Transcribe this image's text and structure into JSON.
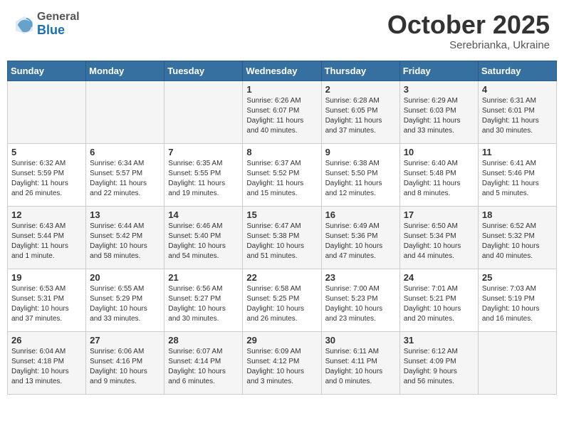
{
  "header": {
    "logo_general": "General",
    "logo_blue": "Blue",
    "month": "October 2025",
    "location": "Serebrianka, Ukraine"
  },
  "weekdays": [
    "Sunday",
    "Monday",
    "Tuesday",
    "Wednesday",
    "Thursday",
    "Friday",
    "Saturday"
  ],
  "weeks": [
    [
      {
        "day": "",
        "content": ""
      },
      {
        "day": "",
        "content": ""
      },
      {
        "day": "",
        "content": ""
      },
      {
        "day": "1",
        "content": "Sunrise: 6:26 AM\nSunset: 6:07 PM\nDaylight: 11 hours\nand 40 minutes."
      },
      {
        "day": "2",
        "content": "Sunrise: 6:28 AM\nSunset: 6:05 PM\nDaylight: 11 hours\nand 37 minutes."
      },
      {
        "day": "3",
        "content": "Sunrise: 6:29 AM\nSunset: 6:03 PM\nDaylight: 11 hours\nand 33 minutes."
      },
      {
        "day": "4",
        "content": "Sunrise: 6:31 AM\nSunset: 6:01 PM\nDaylight: 11 hours\nand 30 minutes."
      }
    ],
    [
      {
        "day": "5",
        "content": "Sunrise: 6:32 AM\nSunset: 5:59 PM\nDaylight: 11 hours\nand 26 minutes."
      },
      {
        "day": "6",
        "content": "Sunrise: 6:34 AM\nSunset: 5:57 PM\nDaylight: 11 hours\nand 22 minutes."
      },
      {
        "day": "7",
        "content": "Sunrise: 6:35 AM\nSunset: 5:55 PM\nDaylight: 11 hours\nand 19 minutes."
      },
      {
        "day": "8",
        "content": "Sunrise: 6:37 AM\nSunset: 5:52 PM\nDaylight: 11 hours\nand 15 minutes."
      },
      {
        "day": "9",
        "content": "Sunrise: 6:38 AM\nSunset: 5:50 PM\nDaylight: 11 hours\nand 12 minutes."
      },
      {
        "day": "10",
        "content": "Sunrise: 6:40 AM\nSunset: 5:48 PM\nDaylight: 11 hours\nand 8 minutes."
      },
      {
        "day": "11",
        "content": "Sunrise: 6:41 AM\nSunset: 5:46 PM\nDaylight: 11 hours\nand 5 minutes."
      }
    ],
    [
      {
        "day": "12",
        "content": "Sunrise: 6:43 AM\nSunset: 5:44 PM\nDaylight: 11 hours\nand 1 minute."
      },
      {
        "day": "13",
        "content": "Sunrise: 6:44 AM\nSunset: 5:42 PM\nDaylight: 10 hours\nand 58 minutes."
      },
      {
        "day": "14",
        "content": "Sunrise: 6:46 AM\nSunset: 5:40 PM\nDaylight: 10 hours\nand 54 minutes."
      },
      {
        "day": "15",
        "content": "Sunrise: 6:47 AM\nSunset: 5:38 PM\nDaylight: 10 hours\nand 51 minutes."
      },
      {
        "day": "16",
        "content": "Sunrise: 6:49 AM\nSunset: 5:36 PM\nDaylight: 10 hours\nand 47 minutes."
      },
      {
        "day": "17",
        "content": "Sunrise: 6:50 AM\nSunset: 5:34 PM\nDaylight: 10 hours\nand 44 minutes."
      },
      {
        "day": "18",
        "content": "Sunrise: 6:52 AM\nSunset: 5:32 PM\nDaylight: 10 hours\nand 40 minutes."
      }
    ],
    [
      {
        "day": "19",
        "content": "Sunrise: 6:53 AM\nSunset: 5:31 PM\nDaylight: 10 hours\nand 37 minutes."
      },
      {
        "day": "20",
        "content": "Sunrise: 6:55 AM\nSunset: 5:29 PM\nDaylight: 10 hours\nand 33 minutes."
      },
      {
        "day": "21",
        "content": "Sunrise: 6:56 AM\nSunset: 5:27 PM\nDaylight: 10 hours\nand 30 minutes."
      },
      {
        "day": "22",
        "content": "Sunrise: 6:58 AM\nSunset: 5:25 PM\nDaylight: 10 hours\nand 26 minutes."
      },
      {
        "day": "23",
        "content": "Sunrise: 7:00 AM\nSunset: 5:23 PM\nDaylight: 10 hours\nand 23 minutes."
      },
      {
        "day": "24",
        "content": "Sunrise: 7:01 AM\nSunset: 5:21 PM\nDaylight: 10 hours\nand 20 minutes."
      },
      {
        "day": "25",
        "content": "Sunrise: 7:03 AM\nSunset: 5:19 PM\nDaylight: 10 hours\nand 16 minutes."
      }
    ],
    [
      {
        "day": "26",
        "content": "Sunrise: 6:04 AM\nSunset: 4:18 PM\nDaylight: 10 hours\nand 13 minutes."
      },
      {
        "day": "27",
        "content": "Sunrise: 6:06 AM\nSunset: 4:16 PM\nDaylight: 10 hours\nand 9 minutes."
      },
      {
        "day": "28",
        "content": "Sunrise: 6:07 AM\nSunset: 4:14 PM\nDaylight: 10 hours\nand 6 minutes."
      },
      {
        "day": "29",
        "content": "Sunrise: 6:09 AM\nSunset: 4:12 PM\nDaylight: 10 hours\nand 3 minutes."
      },
      {
        "day": "30",
        "content": "Sunrise: 6:11 AM\nSunset: 4:11 PM\nDaylight: 10 hours\nand 0 minutes."
      },
      {
        "day": "31",
        "content": "Sunrise: 6:12 AM\nSunset: 4:09 PM\nDaylight: 9 hours\nand 56 minutes."
      },
      {
        "day": "",
        "content": ""
      }
    ]
  ]
}
